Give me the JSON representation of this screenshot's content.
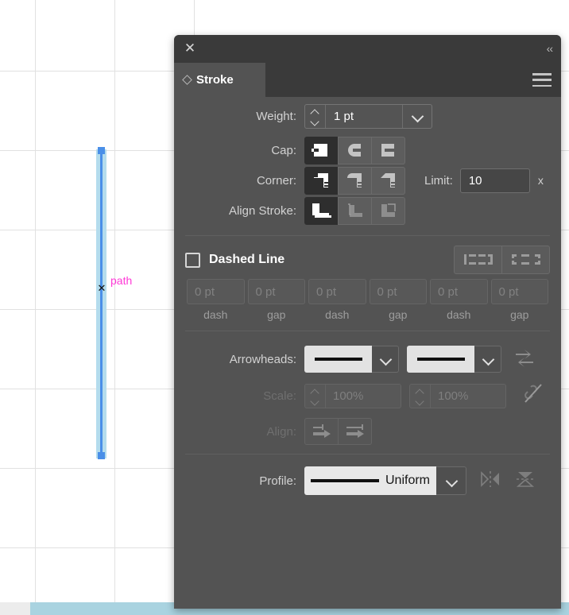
{
  "canvas": {
    "smart_guide_label": "path",
    "cursor_glyph": "✕",
    "grid_color": "#e1e1e1",
    "path_color": "#4a8fe8",
    "path_halo_color": "#b4dced",
    "guide_color": "#ff39d7"
  },
  "panel": {
    "title": "Stroke",
    "close_icon": "✕",
    "collapse_icon": "‹‹",
    "menu_icon": "hamburger-menu-icon",
    "weight": {
      "label": "Weight:",
      "value": "1 pt"
    },
    "cap": {
      "label": "Cap:",
      "options": [
        "butt-cap",
        "round-cap",
        "projecting-cap"
      ],
      "selected_index": 0
    },
    "corner": {
      "label": "Corner:",
      "options": [
        "miter-join",
        "round-join",
        "bevel-join"
      ],
      "selected_index": 0
    },
    "limit": {
      "label": "Limit:",
      "value": "10",
      "suffix": "x"
    },
    "align_stroke": {
      "label": "Align Stroke:",
      "options": [
        "align-center",
        "align-inside",
        "align-outside"
      ],
      "selected_index": 0
    },
    "dashed_line": {
      "label": "Dashed Line",
      "checked": false,
      "cap_options": [
        "dashes-preserve-exact-lengths",
        "dashes-adjust-to-corners"
      ],
      "fields": [
        {
          "value": "0 pt",
          "caption": "dash"
        },
        {
          "value": "0 pt",
          "caption": "gap"
        },
        {
          "value": "0 pt",
          "caption": "dash"
        },
        {
          "value": "0 pt",
          "caption": "gap"
        },
        {
          "value": "0 pt",
          "caption": "dash"
        },
        {
          "value": "0 pt",
          "caption": "gap"
        }
      ]
    },
    "arrowheads": {
      "label": "Arrowheads:",
      "start_value": "None",
      "end_value": "None",
      "swap_icon": "swap-arrowheads-icon"
    },
    "scale": {
      "label": "Scale:",
      "start_value": "100%",
      "end_value": "100%",
      "link_icon": "link-broken-icon",
      "disabled": true
    },
    "align": {
      "label": "Align:",
      "options": [
        "extend-arrow-beyond-end",
        "place-arrow-at-end"
      ],
      "disabled": true
    },
    "profile": {
      "label": "Profile:",
      "value": "Uniform",
      "flip_horizontal_icon": "flip-across-icon",
      "flip_vertical_icon": "flip-along-icon"
    }
  }
}
